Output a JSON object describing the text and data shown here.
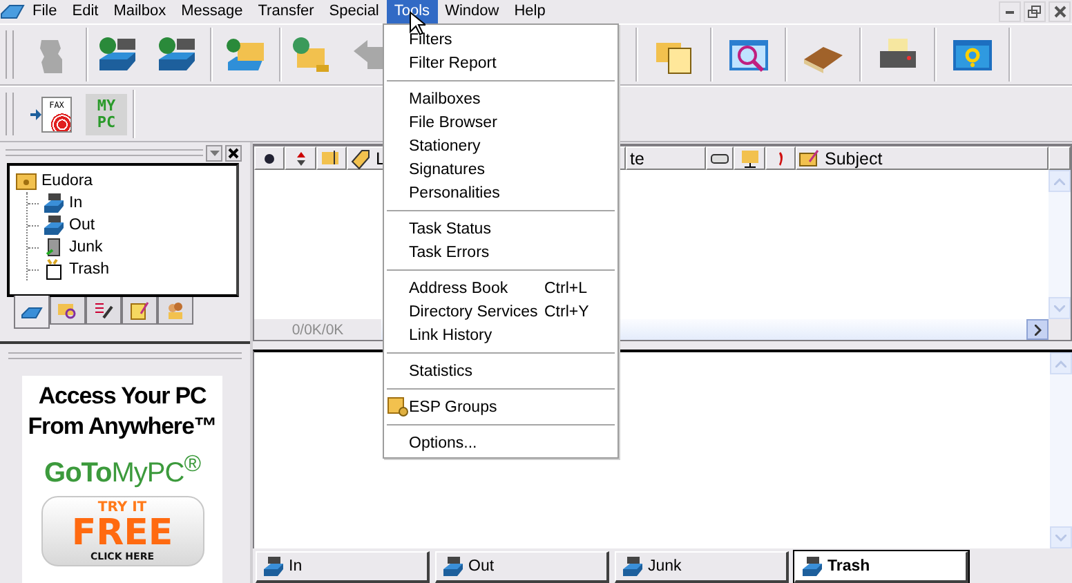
{
  "menu_bar": {
    "items": [
      {
        "label": "File",
        "selected": false
      },
      {
        "label": "Edit",
        "selected": false
      },
      {
        "label": "Mailbox",
        "selected": false
      },
      {
        "label": "Message",
        "selected": false
      },
      {
        "label": "Transfer",
        "selected": false
      },
      {
        "label": "Special",
        "selected": false
      },
      {
        "label": "Tools",
        "selected": true
      },
      {
        "label": "Window",
        "selected": false
      },
      {
        "label": "Help",
        "selected": false
      }
    ]
  },
  "toolbar": {
    "left": [
      {
        "kind": "person",
        "disabled": true
      },
      {
        "kind": "separator"
      },
      {
        "kind": "check-in",
        "disabled": false
      },
      {
        "kind": "send-out",
        "disabled": false
      },
      {
        "kind": "separator"
      },
      {
        "kind": "new-mail",
        "disabled": false
      },
      {
        "kind": "separator"
      },
      {
        "kind": "envelope-globe",
        "disabled": false
      },
      {
        "kind": "reply",
        "disabled": true
      }
    ],
    "right": [
      {
        "kind": "attach",
        "disabled": false
      },
      {
        "kind": "find",
        "disabled": false
      },
      {
        "kind": "book",
        "disabled": false
      },
      {
        "kind": "printer",
        "disabled": false
      },
      {
        "kind": "help",
        "disabled": false
      }
    ],
    "plugins": [
      {
        "kind": "fax",
        "label": "FAX"
      },
      {
        "kind": "text",
        "label": "MY PC"
      }
    ]
  },
  "tools_menu": {
    "items": [
      {
        "kind": "item",
        "label": "Filters"
      },
      {
        "kind": "item",
        "label": "Filter Report"
      },
      {
        "kind": "separator"
      },
      {
        "kind": "item",
        "label": "Mailboxes"
      },
      {
        "kind": "item",
        "label": "File Browser"
      },
      {
        "kind": "item",
        "label": "Stationery"
      },
      {
        "kind": "item",
        "label": "Signatures"
      },
      {
        "kind": "item",
        "label": "Personalities"
      },
      {
        "kind": "separator"
      },
      {
        "kind": "item",
        "label": "Task Status"
      },
      {
        "kind": "item",
        "label": "Task Errors"
      },
      {
        "kind": "separator"
      },
      {
        "kind": "item",
        "label": "Address Book",
        "shortcut": "Ctrl+L"
      },
      {
        "kind": "item",
        "label": "Directory Services",
        "shortcut": "Ctrl+Y"
      },
      {
        "kind": "item",
        "label": "Link History"
      },
      {
        "kind": "separator"
      },
      {
        "kind": "item",
        "label": "Statistics"
      },
      {
        "kind": "separator"
      },
      {
        "kind": "icon-item",
        "label": "ESP Groups"
      },
      {
        "kind": "separator"
      },
      {
        "kind": "item",
        "label": "Options..."
      }
    ]
  },
  "mailbox_tree": {
    "items": [
      {
        "label": "Eudora",
        "kind": "folder",
        "children": [
          {
            "label": "In",
            "kind": "in"
          },
          {
            "label": "Out",
            "kind": "out"
          },
          {
            "label": "Junk",
            "kind": "junk"
          },
          {
            "label": "Trash",
            "kind": "trash"
          }
        ]
      }
    ]
  },
  "side_tabs": [
    {
      "kind": "mailboxes",
      "selected": true
    },
    {
      "kind": "search",
      "selected": false
    },
    {
      "kind": "signatures",
      "selected": false
    },
    {
      "kind": "stationery",
      "selected": false
    },
    {
      "kind": "personalities",
      "selected": false
    }
  ],
  "ad": {
    "headline": [
      "Access Your PC",
      "From Anywhere™"
    ],
    "brand": "**GoTo**MyPC$^{®}$",
    "button": [
      "TRY IT",
      "FREE",
      "CLICK HERE"
    ]
  },
  "message_list": {
    "columns": [
      {
        "kind": "status"
      },
      {
        "kind": "priority"
      },
      {
        "kind": "attachment"
      },
      {
        "kind": "label",
        "label": "L"
      },
      {
        "kind": "date",
        "label": "te"
      },
      {
        "kind": "server"
      },
      {
        "kind": "junk-mail"
      },
      {
        "kind": "mood"
      },
      {
        "kind": "subject",
        "label": "Subject"
      }
    ],
    "status": "0/0K/0K"
  },
  "mailbox_tabs": [
    {
      "label": "In",
      "selected": false
    },
    {
      "label": "Out",
      "selected": false
    },
    {
      "label": "Junk",
      "selected": false
    },
    {
      "label": "Trash",
      "selected": true
    }
  ]
}
